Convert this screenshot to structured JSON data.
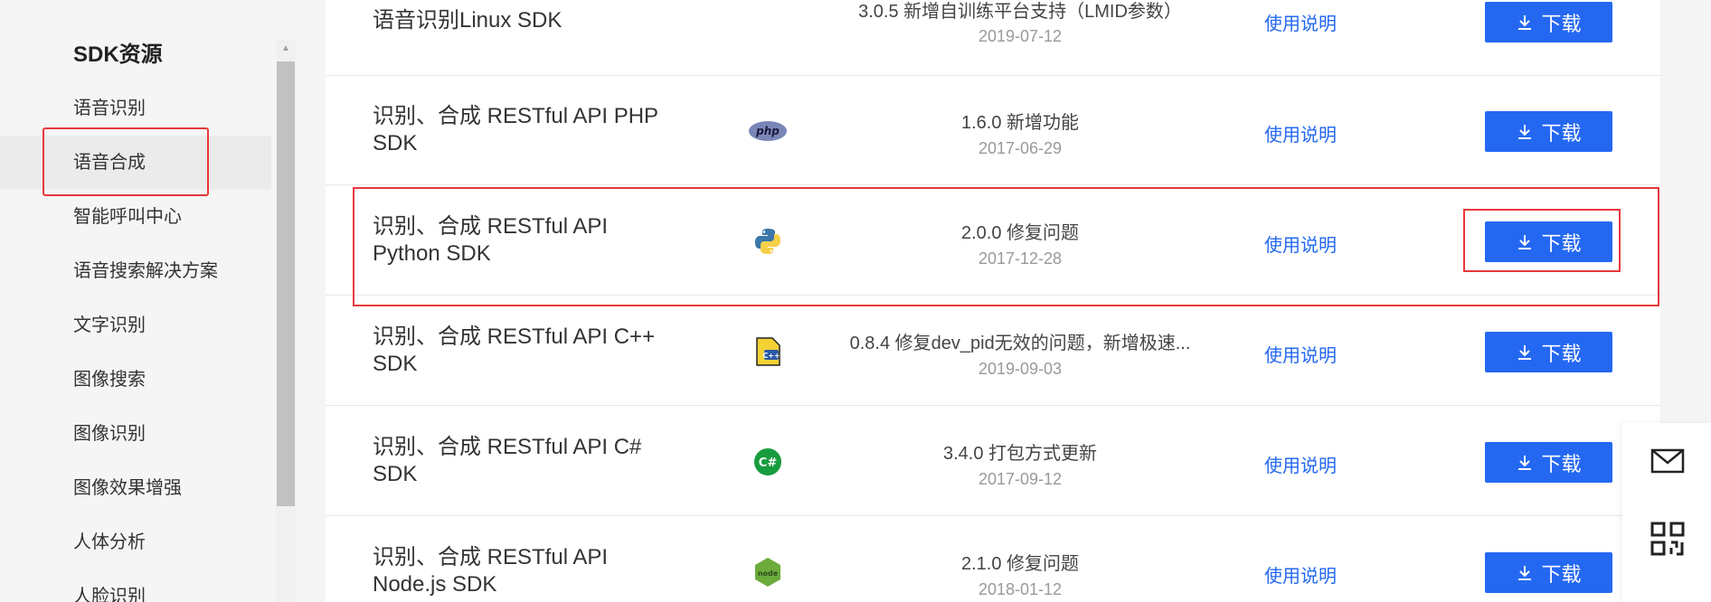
{
  "sidebar": {
    "title": "SDK资源",
    "items": [
      {
        "label": "语音识别",
        "active": false
      },
      {
        "label": "语音合成",
        "active": true
      },
      {
        "label": "智能呼叫中心",
        "active": false
      },
      {
        "label": "语音搜索解决方案",
        "active": false
      },
      {
        "label": "文字识别",
        "active": false
      },
      {
        "label": "图像搜索",
        "active": false
      },
      {
        "label": "图像识别",
        "active": false
      },
      {
        "label": "图像效果增强",
        "active": false
      },
      {
        "label": "人体分析",
        "active": false
      },
      {
        "label": "人脸识别",
        "active": false
      }
    ]
  },
  "sdk_rows": [
    {
      "name": "语音识别Linux SDK",
      "version": "3.0.5 新增自训练平台支持（LMID参数）",
      "date": "2019-07-12",
      "doc_link": "使用说明",
      "download": "下载",
      "icon": "none"
    },
    {
      "name": "识别、合成 RESTful API PHP SDK",
      "version": "1.6.0 新增功能",
      "date": "2017-06-29",
      "doc_link": "使用说明",
      "download": "下载",
      "icon": "php-icon"
    },
    {
      "name": "识别、合成 RESTful API Python SDK",
      "version": "2.0.0 修复问题",
      "date": "2017-12-28",
      "doc_link": "使用说明",
      "download": "下载",
      "icon": "python-icon"
    },
    {
      "name": "识别、合成 RESTful API C++ SDK",
      "version": "0.8.4 修复dev_pid无效的问题，新增极速...",
      "date": "2019-09-03",
      "doc_link": "使用说明",
      "download": "下载",
      "icon": "cpp-icon"
    },
    {
      "name": "识别、合成 RESTful API C# SDK",
      "version": "3.4.0 打包方式更新",
      "date": "2017-09-12",
      "doc_link": "使用说明",
      "download": "下载",
      "icon": "csharp-icon"
    },
    {
      "name": "识别、合成 RESTful API Node.js SDK",
      "version": "2.1.0 修复问题",
      "date": "2018-01-12",
      "doc_link": "使用说明",
      "download": "下载",
      "icon": "nodejs-icon"
    }
  ],
  "icons": {
    "php_text": "php",
    "csharp_text": "C#",
    "cpp_text": "C++",
    "node_text": "node"
  },
  "colors": {
    "accent": "#2468f2",
    "highlight": "#e8383b"
  }
}
